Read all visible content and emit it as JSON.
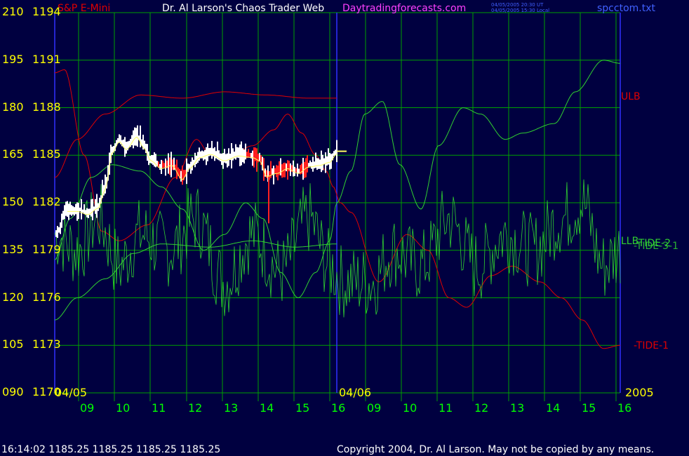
{
  "header": {
    "left": "S&P E-Mini",
    "title": "Dr. Al Larson's Chaos Trader Web",
    "site": "Daytradingforecasts.com",
    "utc_time": "04/05/2005 20:30 UT",
    "local_time": "04/05/2005 15:30 Local",
    "file": "spcctom.txt"
  },
  "footer": {
    "quote": "16:14:02  1185.25 1185.25 1185.25 1185.25",
    "copyright": "Copyright 2004, Dr. Al Larson. May not be copied by any means."
  },
  "colors": {
    "background": "#000040",
    "grid": "#00a000",
    "axis_text": "#ffff00",
    "time_text": "#00ff00",
    "red_line": "#e00000",
    "green_line": "#30d030",
    "price_bar": "#ffffff",
    "divider": "#3030ff",
    "title": "#ffffff",
    "site": "#ff40ff",
    "left_header": "#e00000"
  },
  "chart_data": {
    "type": "line",
    "y_left_labels": [
      "210",
      "195",
      "180",
      "165",
      "150",
      "135",
      "120",
      "105",
      "090"
    ],
    "y_right_labels": [
      "1194",
      "1191",
      "1188",
      "1185",
      "1182",
      "1179",
      "1176",
      "1173",
      "1170"
    ],
    "ylim_price": [
      1170,
      1194
    ],
    "ylim_osc": [
      90,
      210
    ],
    "x_ticks": [
      "09",
      "10",
      "11",
      "12",
      "13",
      "14",
      "15",
      "16",
      "09",
      "10",
      "11",
      "12",
      "13",
      "14",
      "15",
      "16"
    ],
    "date_labels": [
      "04/05",
      "04/06",
      "2005"
    ],
    "series_labels": [
      "ULB",
      "LLB",
      "-TIDE-2",
      "-TIDE-3-1",
      "-TIDE-1"
    ],
    "last_price": 1185.25,
    "grid": true
  }
}
